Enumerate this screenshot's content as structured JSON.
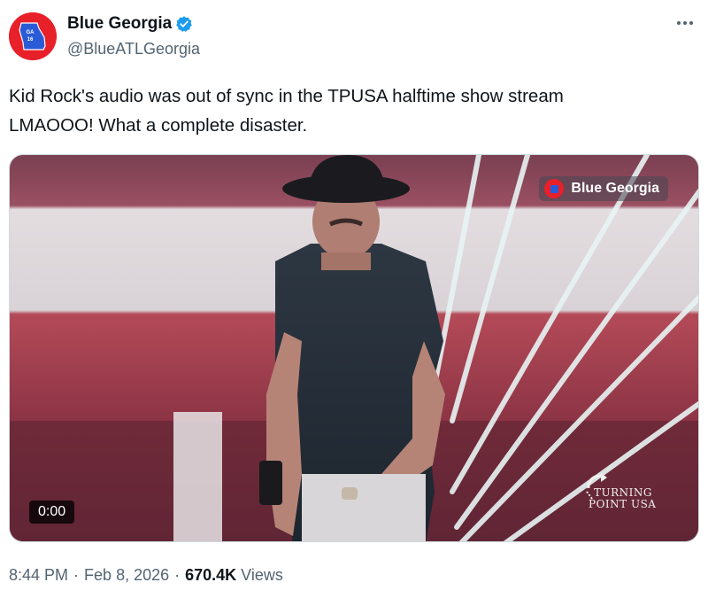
{
  "author": {
    "display_name": "Blue Georgia",
    "handle": "@BlueATLGeorgia",
    "avatar_text": "GA 16",
    "verified": true
  },
  "tweet": {
    "text_line1": "Kid Rock's audio was out of sync in the TPUSA halftime show stream",
    "text_line2": "LMAOOO! What a complete disaster."
  },
  "video": {
    "elapsed": "0:00",
    "watermark_label": "Blue Georgia",
    "logo_line1": "TURNING",
    "logo_line2": "POINT USA"
  },
  "meta": {
    "time": "8:44 PM",
    "date": "Feb 8, 2026",
    "views_count": "670.4K",
    "views_label": "Views"
  },
  "colors": {
    "avatar_red": "#e8202a",
    "verified_blue": "#1d9bf0",
    "secondary_text": "#536471"
  }
}
